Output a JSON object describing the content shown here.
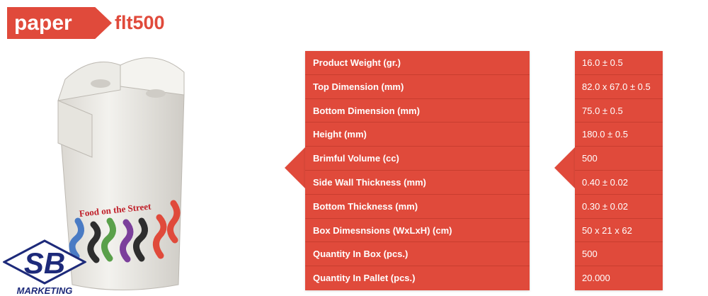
{
  "header": {
    "category": "paper",
    "model": "flt500"
  },
  "product": {
    "print_text": "Food on the Street"
  },
  "logo": {
    "letters": "SB",
    "caption": "MARKETING"
  },
  "specs": [
    {
      "label": "Product Weight   (gr.)",
      "value": "16.0 ± 0.5"
    },
    {
      "label": "Top Dimension   (mm)",
      "value": "82.0 x 67.0 ± 0.5"
    },
    {
      "label": "Bottom Dimension  (mm)",
      "value": "75.0 ± 0.5"
    },
    {
      "label": "Height  (mm)",
      "value": "180.0 ± 0.5"
    },
    {
      "label": "Brimful Volume  (cc)",
      "value": "500"
    },
    {
      "label": "Side Wall Thickness (mm)",
      "value": "0.40 ± 0.02"
    },
    {
      "label": "Bottom Thickness (mm)",
      "value": "0.30 ± 0.02"
    },
    {
      "label": "Box Dimesnsions  (WxLxH) (cm)",
      "value": "50 x 21 x 62"
    },
    {
      "label": "Quantity In Box   (pcs.)",
      "value": "500"
    },
    {
      "label": "Quantity In Pallet  (pcs.)",
      "value": "20.000"
    }
  ],
  "colors": {
    "accent": "#e04a3b",
    "text_on_accent": "#ffffff",
    "logo_navy": "#1d2a7a"
  }
}
